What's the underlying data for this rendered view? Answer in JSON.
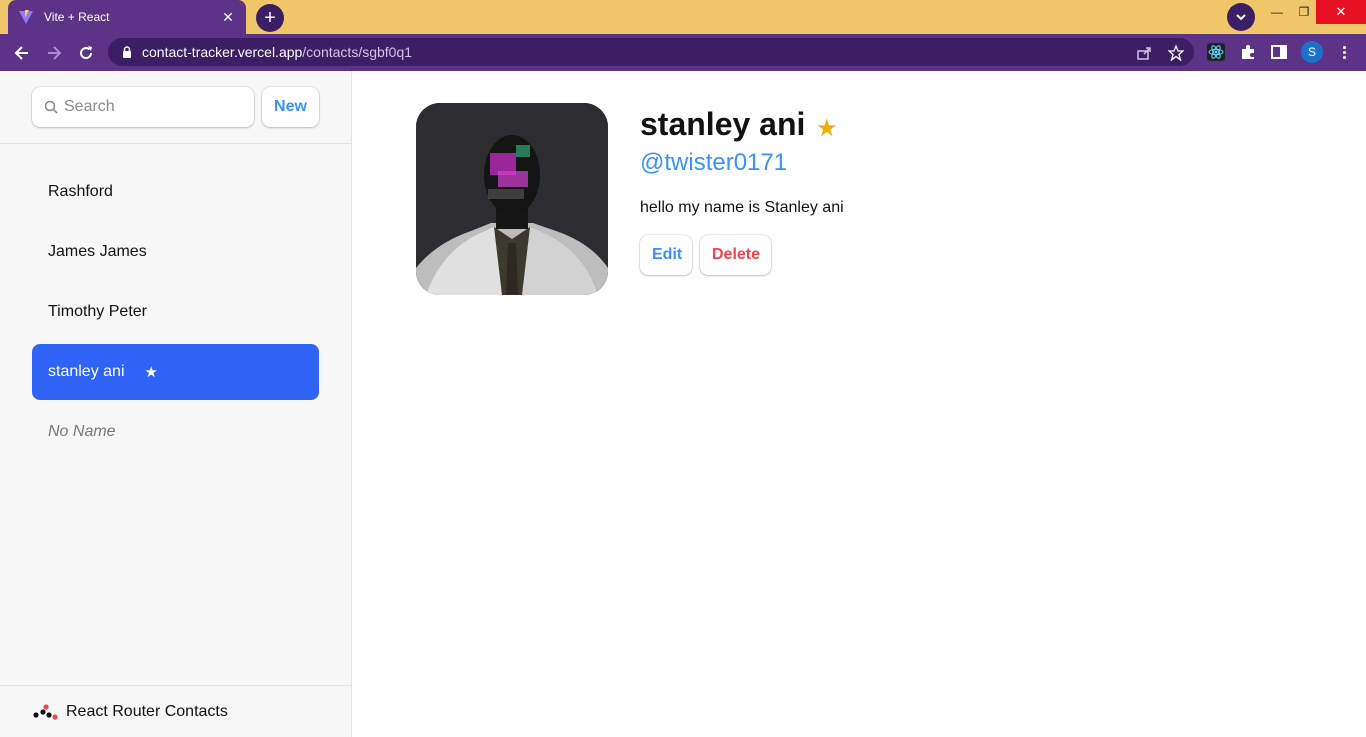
{
  "browser": {
    "tab_title": "Vite + React",
    "new_tab_symbol": "+",
    "close_symbol": "✕",
    "url_host": "contact-tracker.vercel.app",
    "url_path": "/contacts/sgbf0q1",
    "profile_initial": "S",
    "window_controls": {
      "minimize": "—",
      "maximize": "❐",
      "close": "✕"
    },
    "accent_colors": {
      "frame": "#f0c66a",
      "toolbar": "#5c3387",
      "omnibox": "#3b1e63"
    }
  },
  "sidebar": {
    "search_placeholder": "Search",
    "new_button": "New",
    "contacts": [
      {
        "name": "Rashford",
        "favorite": false,
        "active": false
      },
      {
        "name": "James James",
        "favorite": false,
        "active": false
      },
      {
        "name": "Timothy Peter",
        "favorite": false,
        "active": false
      },
      {
        "name": "stanley ani",
        "favorite": true,
        "active": true,
        "star": "★"
      },
      {
        "name": "No Name",
        "favorite": false,
        "active": false
      }
    ],
    "footer_title": "React Router Contacts"
  },
  "contact": {
    "name": "stanley ani",
    "favorite_star": "★",
    "twitter": "@twister0171",
    "notes": "hello my name is Stanley ani",
    "edit_button": "Edit",
    "delete_button": "Delete"
  },
  "colors": {
    "link": "#3992ff",
    "active_item": "#2f64f7",
    "star": "#eeb004",
    "delete": "#f44250"
  }
}
